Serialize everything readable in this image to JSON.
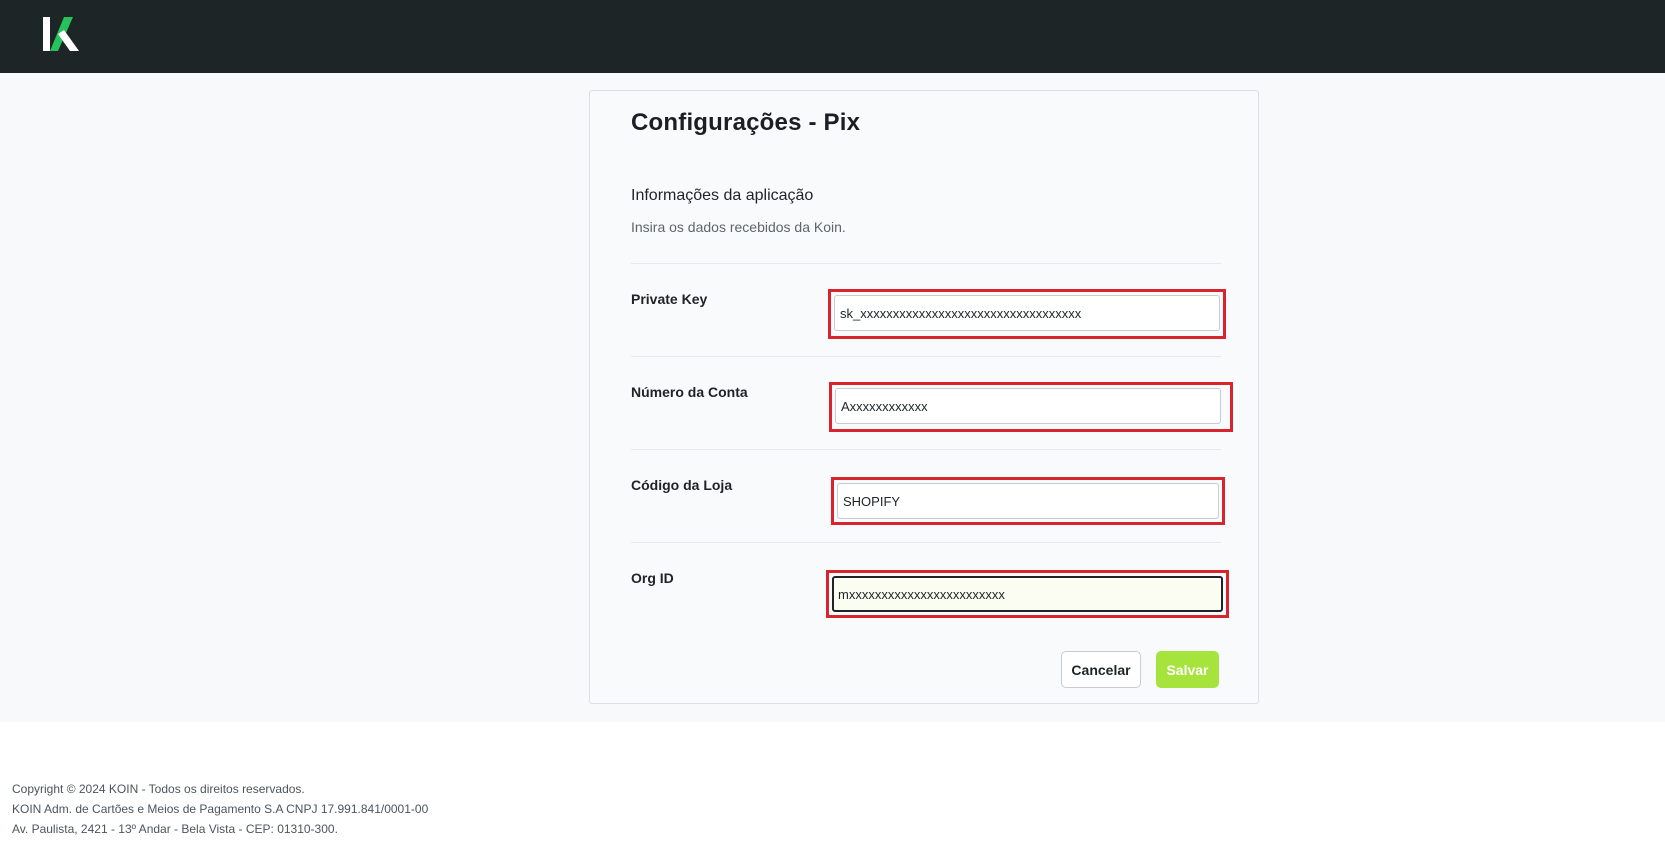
{
  "header": {
    "logo_name": "koin-logo",
    "brand_colors": {
      "dark": "#1e2527",
      "green": "#27c35a"
    }
  },
  "form": {
    "title": "Configurações - Pix",
    "section_title": "Informações da aplicação",
    "section_subtitle": "Insira os dados recebidos da Koin.",
    "fields": [
      {
        "label": "Private Key",
        "value": "sk_xxxxxxxxxxxxxxxxxxxxxxxxxxxxxxxxxx"
      },
      {
        "label": "Número da Conta",
        "value": "Axxxxxxxxxxxx"
      },
      {
        "label": "Código da Loja",
        "value": "SHOPIFY"
      },
      {
        "label": "Org ID",
        "value": "mxxxxxxxxxxxxxxxxxxxxxxxx"
      }
    ],
    "cancel_label": "Cancelar",
    "save_label": "Salvar",
    "save_color": "#a7e33d",
    "highlight_color": "#d9232d"
  },
  "footer": {
    "line1": "Copyright © 2024 KOIN - Todos os direitos reservados.",
    "line2": "KOIN Adm. de Cartões e Meios de Pagamento S.A CNPJ 17.991.841/0001-00",
    "line3": "Av. Paulista, 2421 - 13º Andar - Bela Vista - CEP: 01310-300."
  }
}
